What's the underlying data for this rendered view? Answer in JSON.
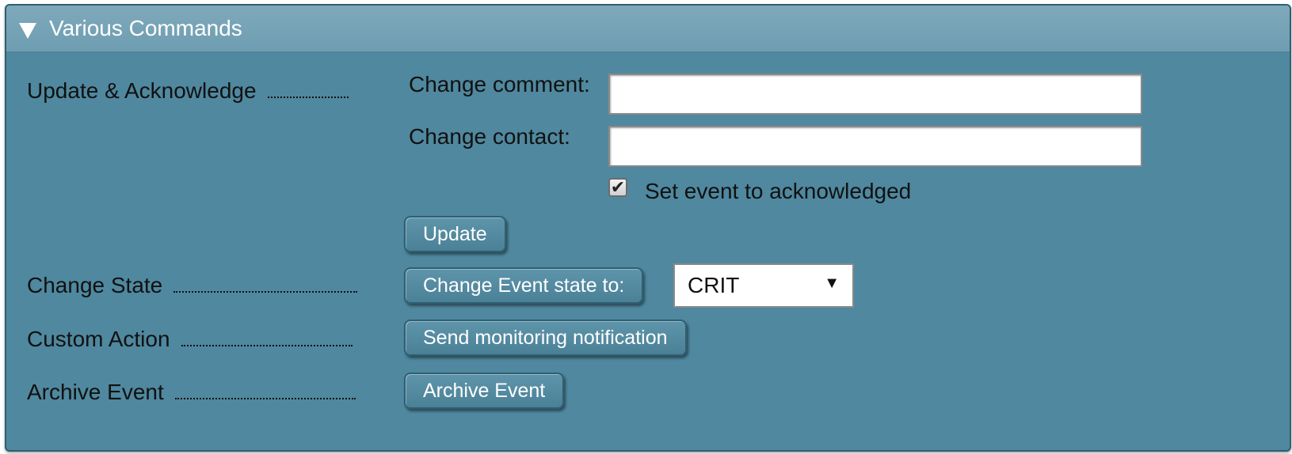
{
  "panel": {
    "title": "Various Commands",
    "collapse_icon": "triangle-down-icon"
  },
  "rows": {
    "update": {
      "label": "Update & Acknowledge",
      "comment_label": "Change comment:",
      "comment_value": "",
      "contact_label": "Change contact:",
      "contact_value": "",
      "ack_checked": true,
      "ack_label": "Set event to acknowledged",
      "button_label": "Update"
    },
    "state": {
      "label": "Change State",
      "button_label": "Change Event state to:",
      "selected": "CRIT",
      "arrow": "▼"
    },
    "custom": {
      "label": "Custom Action",
      "button_label": "Send monitoring notification"
    },
    "archive": {
      "label": "Archive Event",
      "button_label": "Archive Event"
    }
  },
  "colors": {
    "panel_bg": "#4f889f",
    "header_bg": "#74a2b5",
    "button_bg": "#4f889f"
  }
}
